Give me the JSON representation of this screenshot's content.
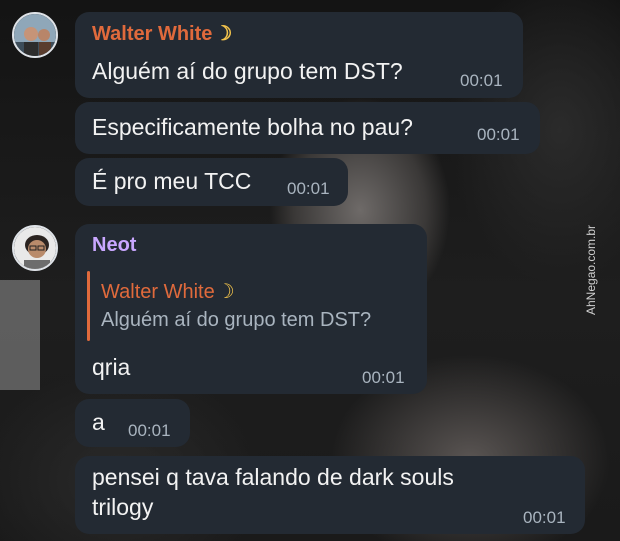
{
  "messages": [
    {
      "sender": "Walter White",
      "text": "Alguém aí do grupo tem DST?",
      "time": "00:01"
    },
    {
      "text": "Especificamente bolha no pau?",
      "time": "00:01"
    },
    {
      "text": "É pro meu TCC",
      "time": "00:01"
    },
    {
      "sender": "Neot",
      "reply": {
        "sender": "Walter White",
        "text": "Alguém aí do grupo tem DST?"
      },
      "text": "qria",
      "time": "00:01"
    },
    {
      "text": "a",
      "time": "00:01"
    },
    {
      "text_line1": "pensei q tava falando de dark souls",
      "text_line2": "trilogy",
      "time": "00:01"
    }
  ],
  "moon_glyph": "☽",
  "watermark": "AhNegao.com.br",
  "colors": {
    "bubble": "#232a33",
    "walter_name": "#e06a3c",
    "neot_name": "#c9a7ff",
    "time": "#a9b4bf"
  }
}
